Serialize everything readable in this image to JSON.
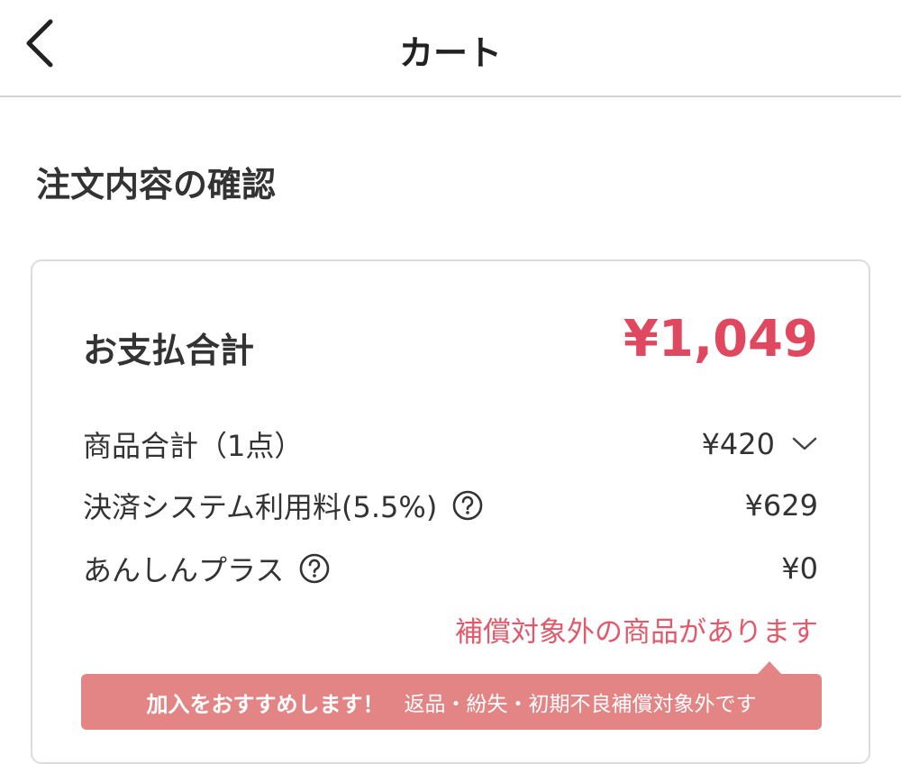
{
  "header": {
    "title": "カート",
    "back_icon": "chevron-left-icon"
  },
  "section": {
    "title": "注文内容の確認"
  },
  "payment": {
    "total_label": "お支払合計",
    "total_value": "¥1,049",
    "accent_color": "#e0485f",
    "rows": [
      {
        "label": "商品合計（1点）",
        "value": "¥420",
        "icon": "chevron-down-icon"
      },
      {
        "label": "決済システム利用料(5.5%)",
        "value": "¥629",
        "icon": "help-circle-icon"
      },
      {
        "label": "あんしんプラス",
        "value": "¥0",
        "icon": "help-circle-icon"
      }
    ],
    "warning_text": "補償対象外の商品があります",
    "banner": {
      "strong": "加入をおすすめします！",
      "sub": "返品・紛失・初期不良補償対象外です",
      "color": "#e38585"
    }
  }
}
